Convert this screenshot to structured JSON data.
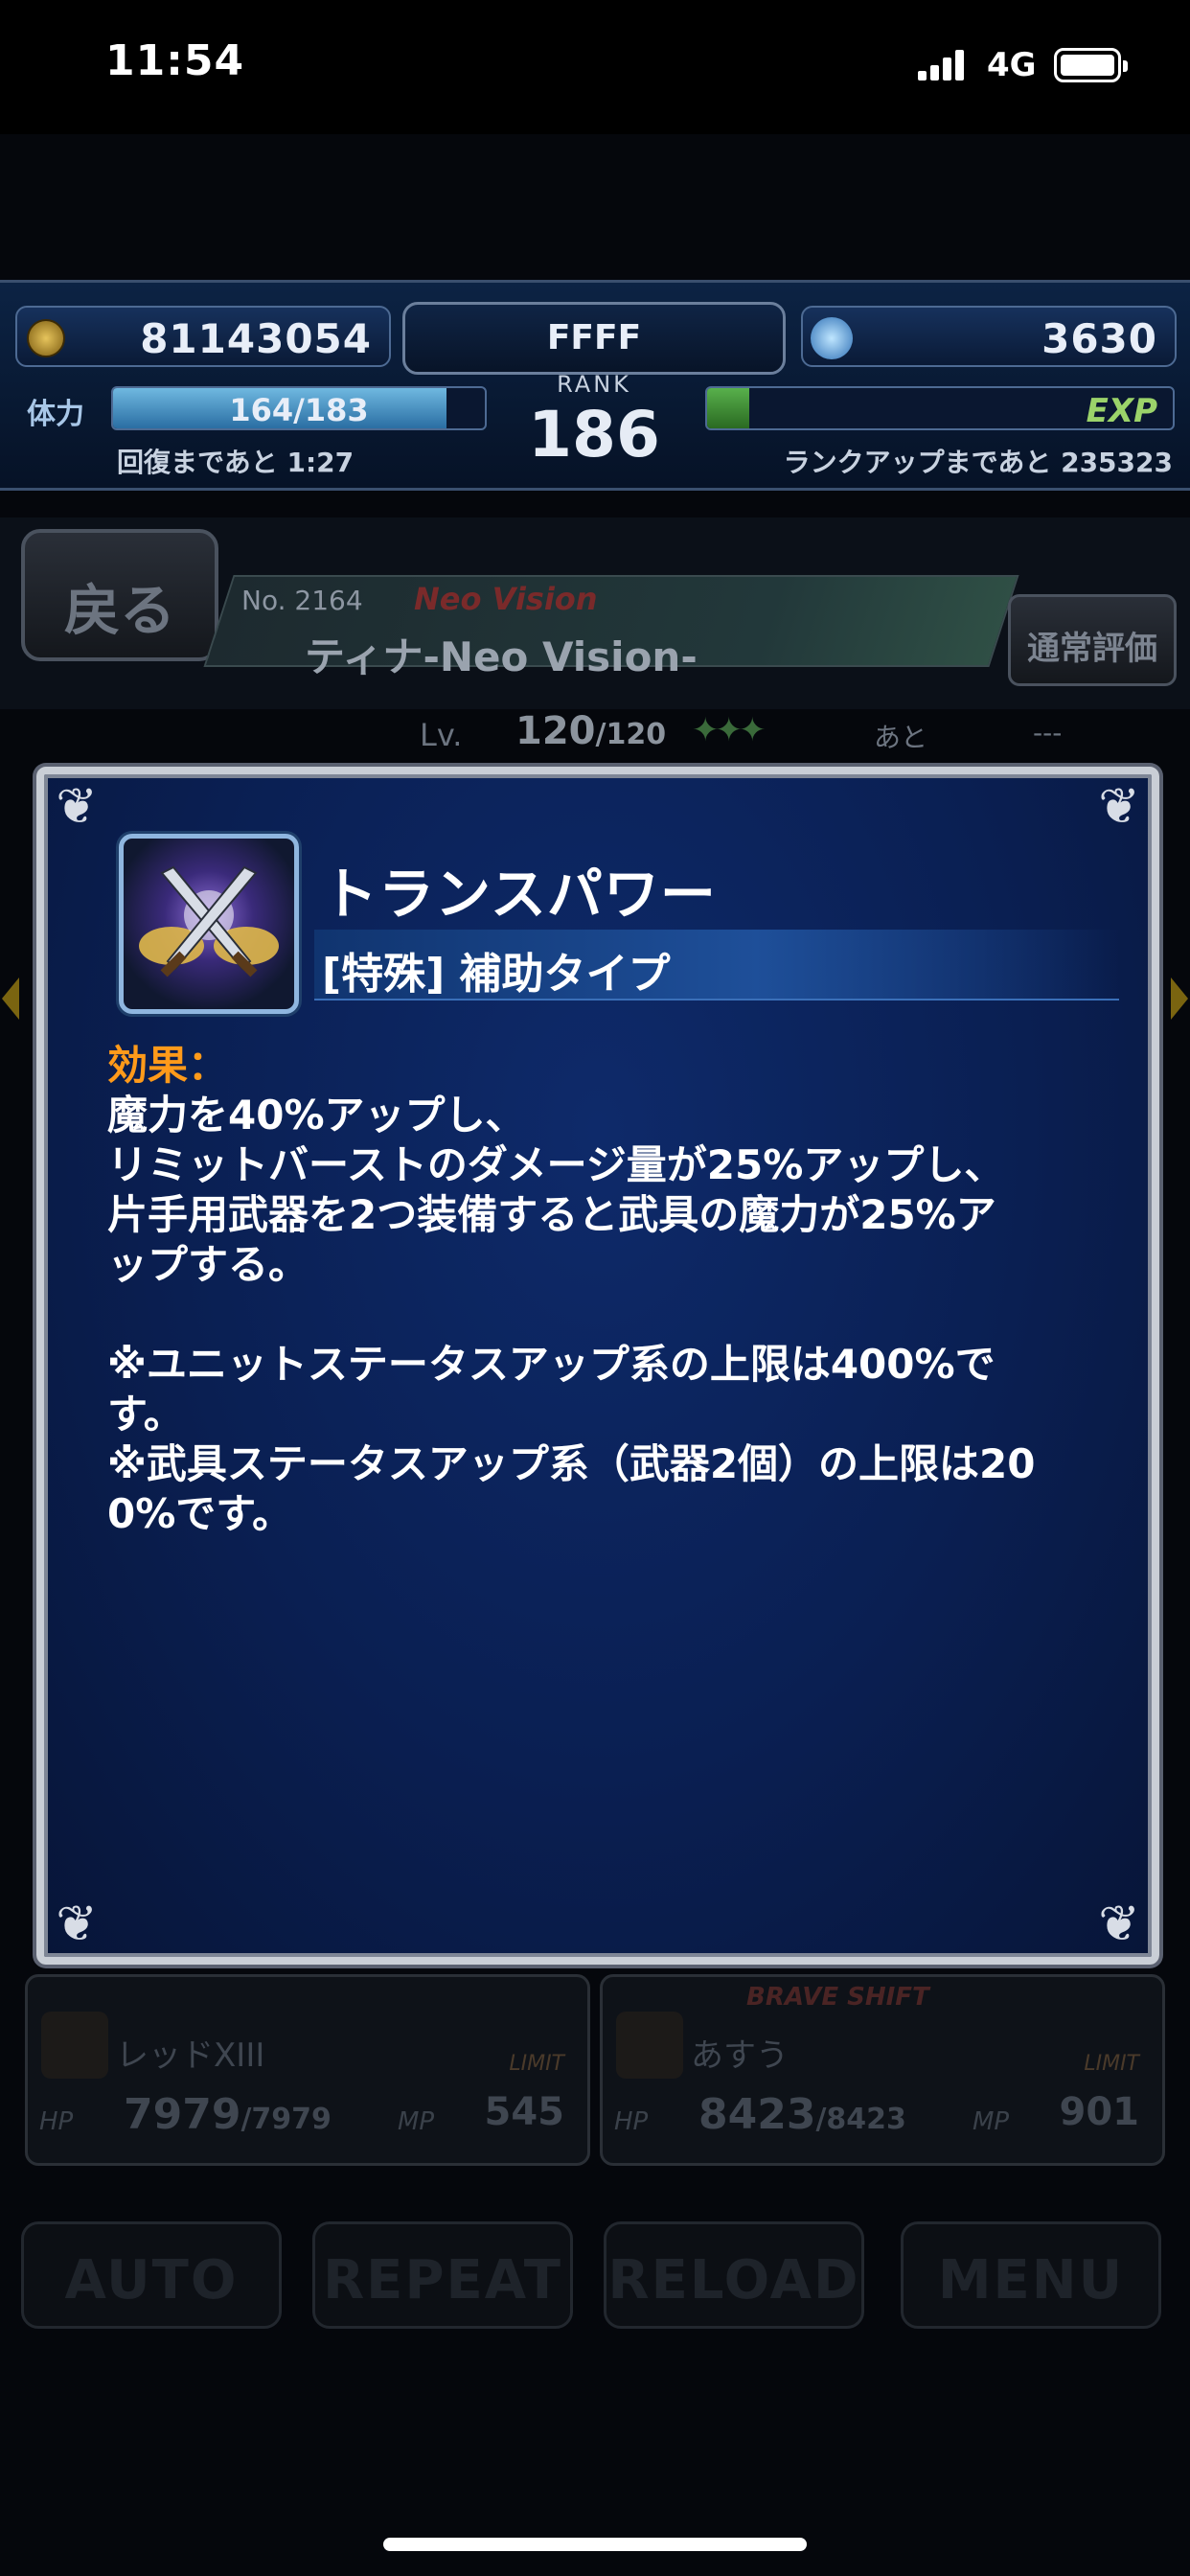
{
  "status_bar": {
    "time": "11:54",
    "network": "4G"
  },
  "hud": {
    "gil": "81143054",
    "player_name": "FFFF",
    "lapis": "3630",
    "rank_label": "RANK",
    "rank": "186",
    "stamina_label": "体力",
    "stamina": "164/183",
    "stamina_fraction": 0.896,
    "recover_text": "回復まであと 1:27",
    "exp_label": "EXP",
    "exp_fraction": 0.09,
    "rankup_text": "ランクアップまであと 235323"
  },
  "unit": {
    "back_label": "戻る",
    "number": "No. 2164",
    "tag": "Neo Vision",
    "name": "ティナ-Neo Vision-",
    "eval_label": "通常評価",
    "lv_label": "Lv.",
    "lv_current": "120",
    "lv_max": "/120",
    "lv_stars": "✦✦✦",
    "ato_label": "あと",
    "ato_value": "---"
  },
  "ability": {
    "name": "トランスパワー",
    "type": "[特殊] 補助タイプ",
    "effect_label": "効果",
    "effect_colon": "：",
    "lines": [
      "魔力を40%アップし、",
      "リミットバーストのダメージ量が25%アップし、",
      "片手用武器を2つ装備すると武具の魔力が25%ア",
      "ップする。"
    ],
    "notes": [
      "※ユニットステータスアップ系の上限は400%で",
      "す。",
      "※武具ステータスアップ系（武器2個）の上限は20",
      "0%です。"
    ]
  },
  "party": [
    {
      "name": "レッドXIII",
      "hp_label": "HP",
      "hp": "7979",
      "hp_max": "/7979",
      "mp_label": "MP",
      "mp": "545",
      "limit_label": "LIMIT"
    },
    {
      "name": "あすう",
      "hp_label": "HP",
      "hp": "8423",
      "hp_max": "/8423",
      "mp_label": "MP",
      "mp": "901",
      "limit_label": "LIMIT",
      "brave_label": "BRAVE SHIFT"
    }
  ],
  "commands": {
    "auto": "AUTO",
    "repeat": "REPEAT",
    "reload": "RELOAD",
    "menu": "MENU"
  }
}
